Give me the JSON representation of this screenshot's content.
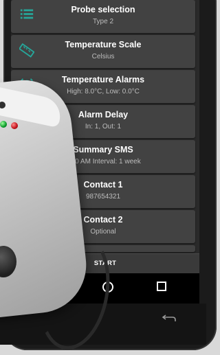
{
  "settings": {
    "items": [
      {
        "title": "Probe selection",
        "subtitle": "Type 2",
        "icon": "list-icon"
      },
      {
        "title": "Temperature Scale",
        "subtitle": "Celsius",
        "icon": "ruler-icon"
      },
      {
        "title": "Temperature Alarms",
        "subtitle": "High: 8.0°C, Low: 0.0°C",
        "icon": "alarm-clock-icon"
      },
      {
        "title": "Alarm Delay",
        "subtitle": "In: 1, Out: 1",
        "icon": ""
      },
      {
        "title": "Summary SMS",
        "subtitle": "9:50 AM Interval: 1 week",
        "icon": ""
      },
      {
        "title": "Contact 1",
        "subtitle": "987654321",
        "icon": ""
      },
      {
        "title": "Contact 2",
        "subtitle": "Optional",
        "icon": ""
      }
    ],
    "start_label": "START"
  },
  "colors": {
    "accent": "#26a69a",
    "card": "#424242",
    "background": "#2a2a2a"
  }
}
